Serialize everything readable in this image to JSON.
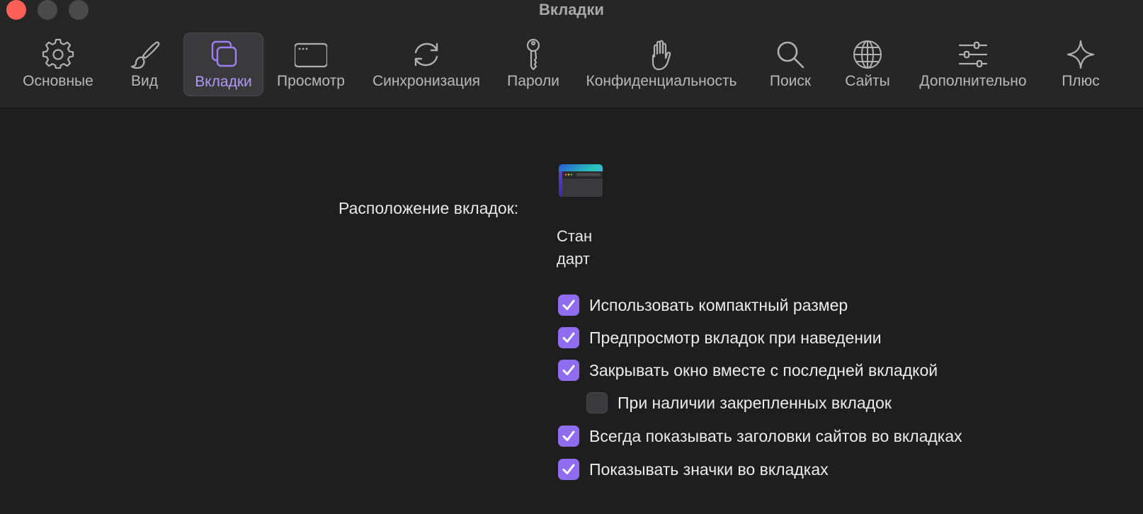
{
  "window": {
    "title": "Вкладки"
  },
  "toolbar": {
    "items": [
      {
        "label": "Основные",
        "icon": "gear-icon",
        "selected": false
      },
      {
        "label": "Вид",
        "icon": "paintbrush-icon",
        "selected": false
      },
      {
        "label": "Вкладки",
        "icon": "tabs-icon",
        "selected": true
      },
      {
        "label": "Просмотр",
        "icon": "browser-window-icon",
        "selected": false
      },
      {
        "label": "Синхронизация",
        "icon": "sync-icon",
        "selected": false
      },
      {
        "label": "Пароли",
        "icon": "key-icon",
        "selected": false
      },
      {
        "label": "Конфиденциальность",
        "icon": "hand-icon",
        "selected": false
      },
      {
        "label": "Поиск",
        "icon": "magnifier-icon",
        "selected": false
      },
      {
        "label": "Сайты",
        "icon": "globe-icon",
        "selected": false
      },
      {
        "label": "Дополнительно",
        "icon": "sliders-icon",
        "selected": false
      },
      {
        "label": "Плюс",
        "icon": "sparkle-icon",
        "selected": false
      }
    ]
  },
  "tab_layout": {
    "label": "Расположение вкладок:",
    "option_caption": "Стандарт"
  },
  "checkboxes": [
    {
      "label": "Использовать компактный размер",
      "checked": true
    },
    {
      "label": "Предпросмотр вкладок при наведении",
      "checked": true
    },
    {
      "label": "Закрывать окно вместе с последней вкладкой",
      "checked": true
    },
    {
      "label": "При наличии закрепленных вкладок",
      "checked": false
    },
    {
      "label": "Всегда показывать заголовки сайтов во вкладках",
      "checked": true
    },
    {
      "label": "Показывать значки во вкладках",
      "checked": true
    }
  ],
  "colors": {
    "accent": "#8f6cf0",
    "selected_label": "#b097f5",
    "close_button": "#fe5f57",
    "background": "#1e1e1e"
  }
}
